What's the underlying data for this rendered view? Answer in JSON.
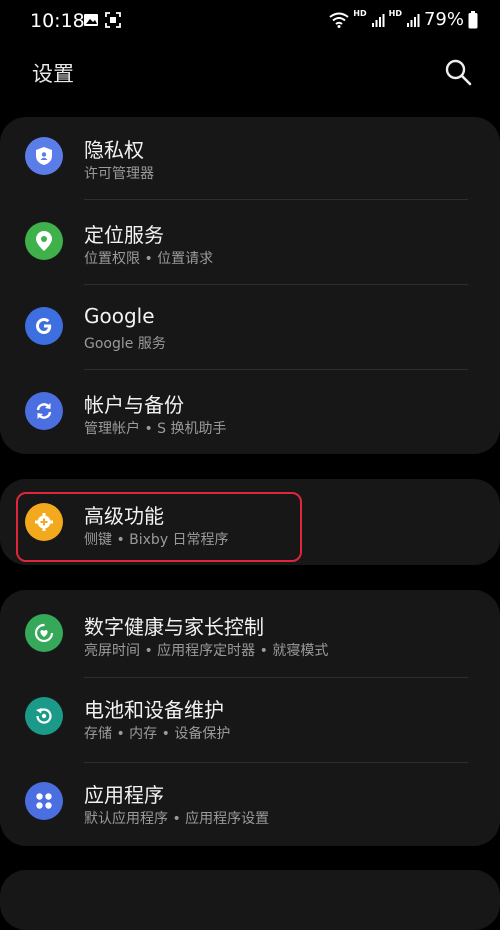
{
  "status_bar": {
    "time": "10:18",
    "battery": "79%",
    "hd1": "HD",
    "hd2": "HD"
  },
  "header": {
    "title": "设置"
  },
  "items": [
    {
      "title": "隐私权",
      "subtitle": "许可管理器",
      "icon": "shield-icon",
      "color": "#5b7de8"
    },
    {
      "title": "定位服务",
      "subtitle": "位置权限 • 位置请求",
      "icon": "location-pin-icon",
      "color": "#3fb04a"
    },
    {
      "title": "Google",
      "subtitle": "Google 服务",
      "icon": "google-icon",
      "color": "#3d6fe0"
    },
    {
      "title": "帐户与备份",
      "subtitle": "管理帐户 • S 换机助手",
      "icon": "sync-icon",
      "color": "#4b6fe0"
    },
    {
      "title": "高级功能",
      "subtitle": "侧键 • Bixby 日常程序",
      "icon": "gear-plus-icon",
      "color": "#f2a91e"
    },
    {
      "title": "数字健康与家长控制",
      "subtitle": "亮屏时间 • 应用程序定时器 • 就寝模式",
      "icon": "wellbeing-icon",
      "color": "#36a85a"
    },
    {
      "title": "电池和设备维护",
      "subtitle": "存储 • 内存 • 设备保护",
      "icon": "device-care-icon",
      "color": "#1b9a8a"
    },
    {
      "title": "应用程序",
      "subtitle": "默认应用程序 • 应用程序设置",
      "icon": "apps-grid-icon",
      "color": "#4b6fe0"
    }
  ],
  "highlight_color": "#e0263a"
}
